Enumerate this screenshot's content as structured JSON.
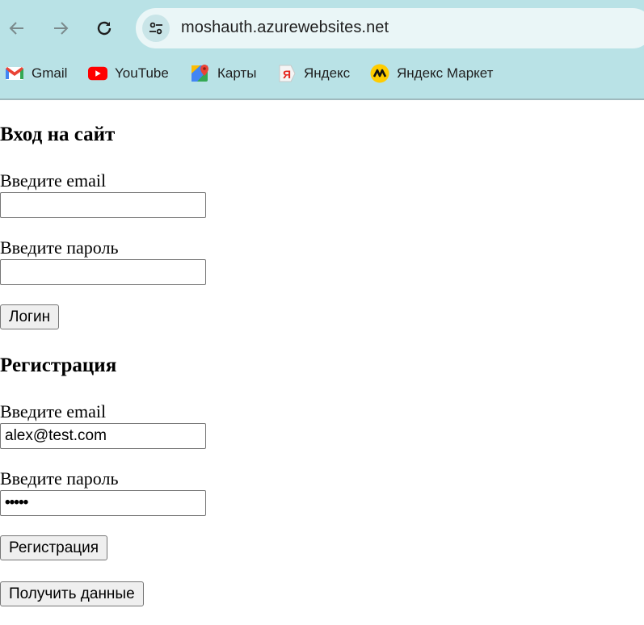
{
  "browser": {
    "url": "moshauth.azurewebsites.net",
    "nav_icons": [
      "back-arrow-icon",
      "forward-arrow-icon",
      "reload-icon",
      "site-info-icon"
    ],
    "bookmarks": [
      {
        "label": "Gmail",
        "icon": "gmail-icon"
      },
      {
        "label": "YouTube",
        "icon": "youtube-icon"
      },
      {
        "label": "Карты",
        "icon": "maps-icon"
      },
      {
        "label": "Яндекс",
        "icon": "yandex-icon"
      },
      {
        "label": "Яндекс Маркет",
        "icon": "yandex-market-icon"
      }
    ],
    "chrome_color": "#b9e2e6"
  },
  "login": {
    "title": "Вход на сайт",
    "email_label": "Введите email",
    "email_value": "",
    "password_label": "Введите пароль",
    "password_value": "",
    "submit_label": "Логин"
  },
  "register": {
    "title": "Регистрация",
    "email_label": "Введите email",
    "email_value": "alex@test.com",
    "password_label": "Введите пароль",
    "password_value": "•••••",
    "submit_label": "Регистрация"
  },
  "get_data_label": "Получить данные"
}
